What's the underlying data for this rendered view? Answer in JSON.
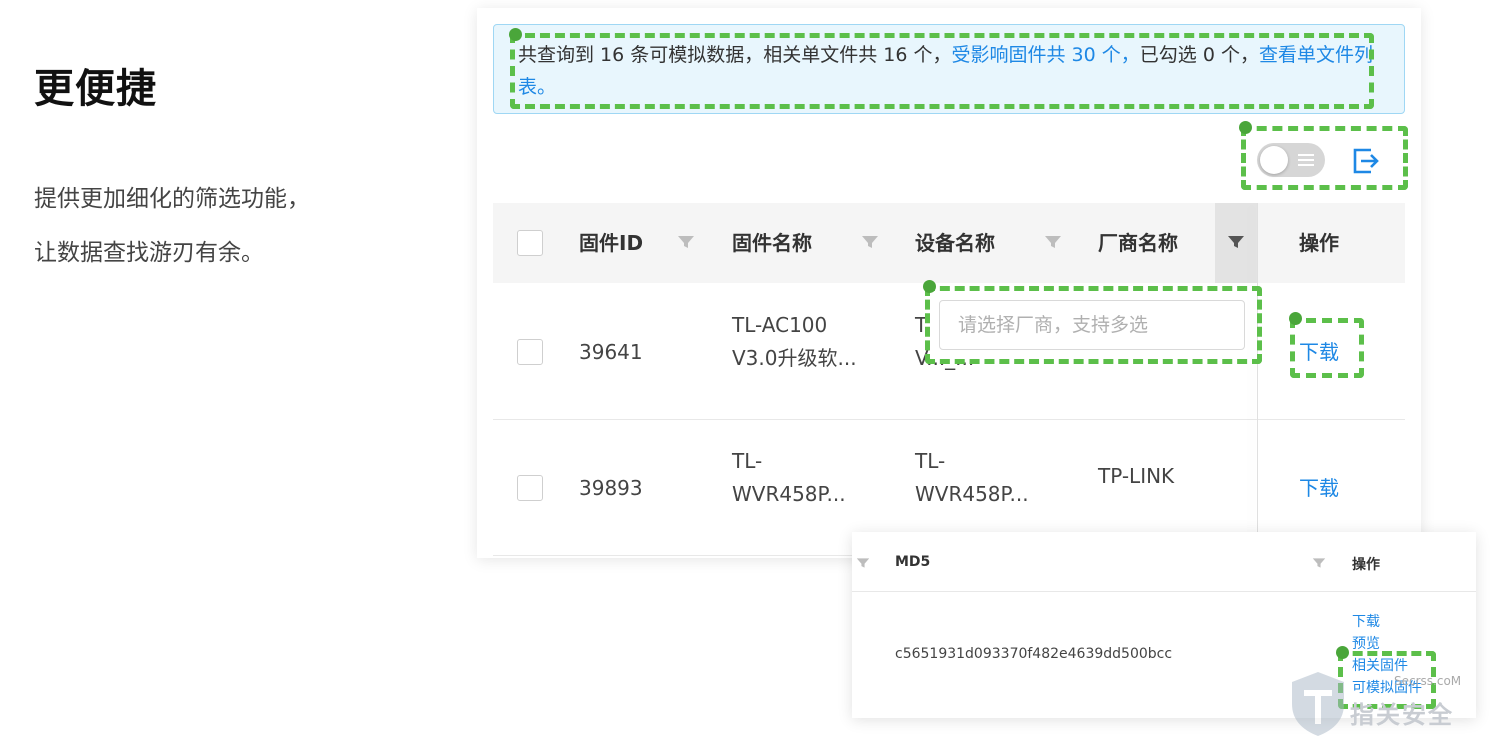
{
  "headline": "更便捷",
  "description": {
    "line1": "提供更加细化的筛选功能，",
    "line2": "让数据查找游刃有余。"
  },
  "banner": {
    "part1": "共查询到 16 条可模拟数据，相关单文件共 16 个，",
    "link1": "受影响固件共 30 个，",
    "part2": "已勾选 0 个，",
    "link2": "查看单文件列表。"
  },
  "toolbar": {
    "toggle_icon": "list-toggle-icon",
    "export_icon": "export-icon"
  },
  "table": {
    "columns": [
      "固件ID",
      "固件名称",
      "设备名称",
      "厂商名称",
      "操作"
    ],
    "filter_icon": "filter-icon",
    "vendor_filter_placeholder": "请选择厂商，支持多选",
    "rows": [
      {
        "id": "39641",
        "name_l1": "TL-AC100",
        "name_l2": "V3.0升级软...",
        "device_l1": "T",
        "device_l2": "V..._...",
        "vendor": "",
        "action": "下载"
      },
      {
        "id": "39893",
        "name_l1": "TL-",
        "name_l2": "WVR458P...",
        "device_l1": "TL-",
        "device_l2": "WVR458P...",
        "vendor": "TP-LINK",
        "action": "下载"
      }
    ]
  },
  "panel2": {
    "col_md5": "MD5",
    "col_action": "操作",
    "md5": "c5651931d093370f482e4639dd500bcc",
    "actions": [
      "下载",
      "预览",
      "相关固件",
      "可模拟固件"
    ]
  },
  "watermark": {
    "url": "Secrss.coM",
    "text": "指关安全"
  },
  "colors": {
    "highlight": "#5cbf4a",
    "link": "#1e88e5",
    "banner_bg": "#e8f6fd"
  }
}
